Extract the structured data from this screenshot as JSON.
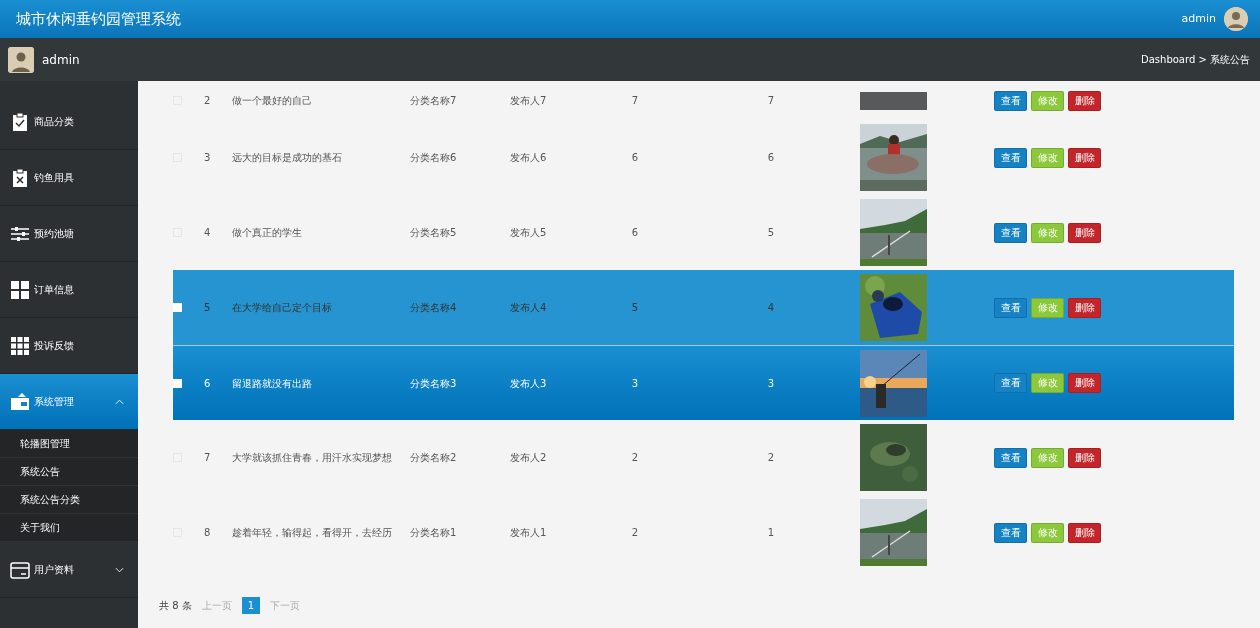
{
  "header": {
    "title": "城市休闲垂钓园管理系统",
    "user": "admin"
  },
  "subbar": {
    "user": "admin",
    "breadcrumb": "Dashboard > 系统公告"
  },
  "sidebar": {
    "items": [
      {
        "label": "商品分类",
        "selected": false
      },
      {
        "label": "钓鱼用具",
        "selected": false
      },
      {
        "label": "预约池塘",
        "selected": false
      },
      {
        "label": "订单信息",
        "selected": false
      },
      {
        "label": "投诉反馈",
        "selected": false
      },
      {
        "label": "系统管理",
        "expanded": true,
        "selected": true,
        "children": [
          {
            "label": "轮播图管理"
          },
          {
            "label": "系统公告"
          },
          {
            "label": "系统公告分类"
          },
          {
            "label": "关于我们"
          }
        ]
      },
      {
        "label": "用户资料",
        "expanded": false,
        "selected": false
      }
    ]
  },
  "table": {
    "rows": [
      {
        "index": "2",
        "title": "做一个最好的自己",
        "category": "分类名称7",
        "publisher": "发布人7",
        "column_5": "7",
        "column_6": "7",
        "image": {
          "kind": "picture"
        },
        "selected": false,
        "hovered": false,
        "actions": [
          {
            "kind": "view",
            "label": "查看"
          },
          {
            "kind": "edit",
            "label": "修改"
          },
          {
            "kind": "delete",
            "label": "删除"
          }
        ]
      },
      {
        "index": "3",
        "title": "远大的目标是成功的基石",
        "category": "分类名称6",
        "publisher": "发布人6",
        "column_5": "6",
        "column_6": "6",
        "image": {
          "kind": "picture"
        },
        "selected": false,
        "hovered": false,
        "actions": [
          {
            "kind": "view",
            "label": "查看"
          },
          {
            "kind": "edit",
            "label": "修改"
          },
          {
            "kind": "delete",
            "label": "删除"
          }
        ]
      },
      {
        "index": "4",
        "title": "做个真正的学生",
        "category": "分类名称5",
        "publisher": "发布人5",
        "column_5": "6",
        "column_6": "5",
        "image": {
          "kind": "picture"
        },
        "selected": false,
        "hovered": false,
        "actions": [
          {
            "kind": "view",
            "label": "查看"
          },
          {
            "kind": "edit",
            "label": "修改"
          },
          {
            "kind": "delete",
            "label": "删除"
          }
        ]
      },
      {
        "index": "5",
        "title": "在大学给自己定个目标",
        "category": "分类名称4",
        "publisher": "发布人4",
        "column_5": "5",
        "column_6": "4",
        "image": {
          "kind": "picture"
        },
        "selected": false,
        "hovered": true,
        "actions": [
          {
            "kind": "view",
            "label": "查看"
          },
          {
            "kind": "edit",
            "label": "修改"
          },
          {
            "kind": "delete",
            "label": "删除"
          }
        ]
      },
      {
        "index": "6",
        "title": "留退路就没有出路",
        "category": "分类名称3",
        "publisher": "发布人3",
        "column_5": "3",
        "column_6": "3",
        "image": {
          "kind": "picture"
        },
        "selected": true,
        "hovered": false,
        "actions": [
          {
            "kind": "view",
            "label": "查看"
          },
          {
            "kind": "edit",
            "label": "修改"
          },
          {
            "kind": "delete",
            "label": "删除"
          }
        ]
      },
      {
        "index": "7",
        "title": "大学就该抓住青春，用汗水实现梦想",
        "category": "分类名称2",
        "publisher": "发布人2",
        "column_5": "2",
        "column_6": "2",
        "image": {
          "kind": "picture"
        },
        "selected": false,
        "hovered": false,
        "actions": [
          {
            "kind": "view",
            "label": "查看"
          },
          {
            "kind": "edit",
            "label": "修改"
          },
          {
            "kind": "delete",
            "label": "删除"
          }
        ]
      },
      {
        "index": "8",
        "title": "趁着年轻，输得起，看得开，去经历",
        "category": "分类名称1",
        "publisher": "发布人1",
        "column_5": "2",
        "column_6": "1",
        "image": {
          "kind": "picture"
        },
        "selected": false,
        "hovered": false,
        "actions": [
          {
            "kind": "view",
            "label": "查看"
          },
          {
            "kind": "edit",
            "label": "修改"
          },
          {
            "kind": "delete",
            "label": "删除"
          }
        ]
      }
    ]
  },
  "pagination": {
    "total": "共 8 条",
    "prev": "上一页",
    "pages": [
      {
        "label": "1",
        "selected": true
      }
    ],
    "next": "下一页"
  }
}
